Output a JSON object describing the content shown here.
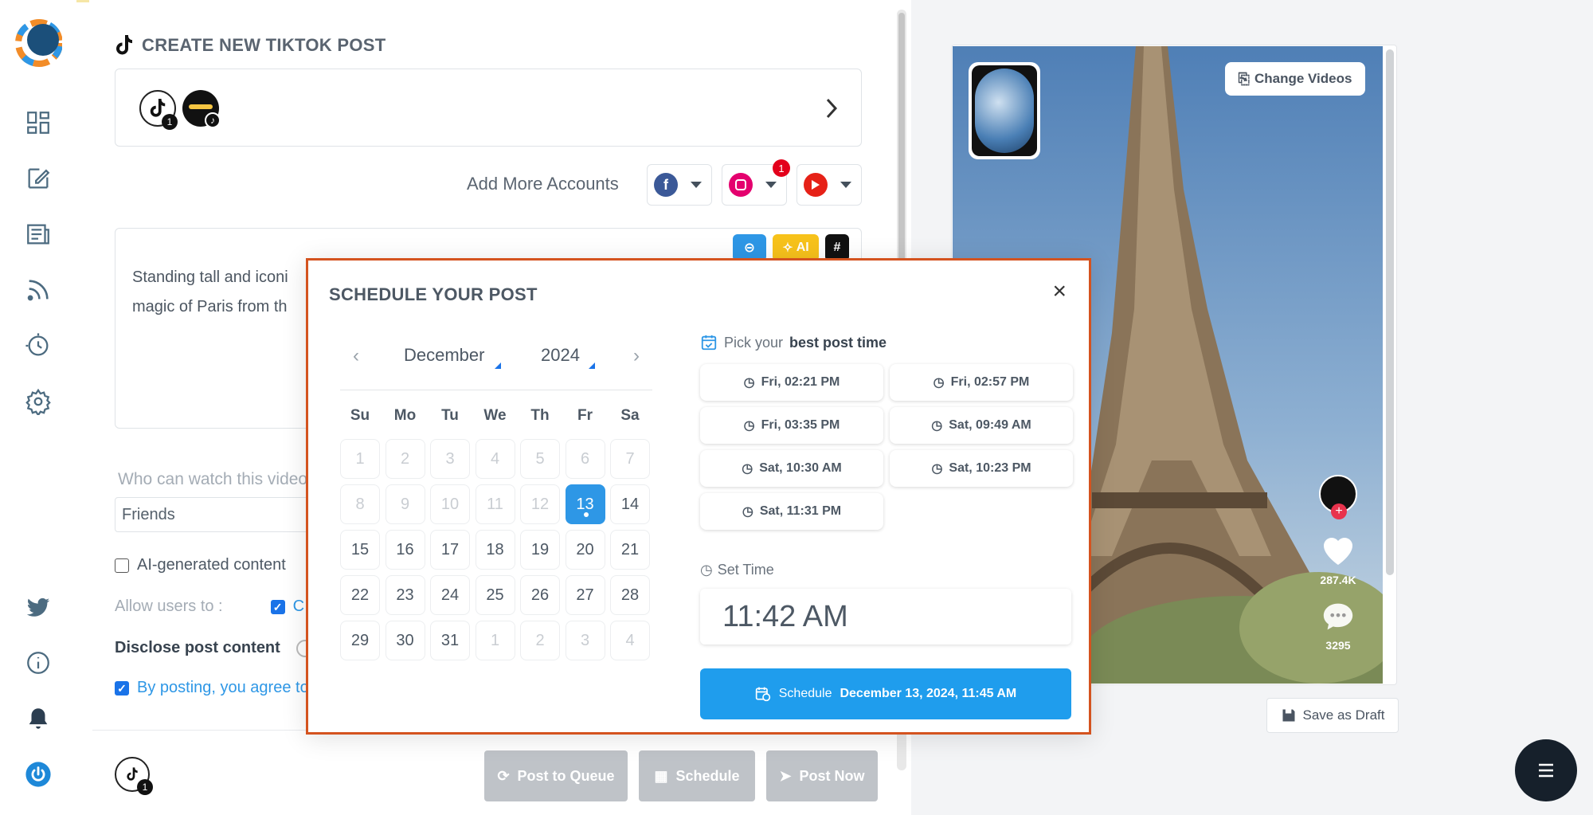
{
  "rail": {
    "items": [
      "dashboard-icon",
      "compose-icon",
      "posts-icon",
      "rss-icon",
      "history-icon",
      "settings-icon",
      "twitter-icon",
      "info-icon",
      "bell-icon",
      "power-icon"
    ]
  },
  "header": {
    "title": "CREATE NEW TIKTOK POST"
  },
  "accounts": {
    "primary_badge": "1",
    "more_label": "Add More Accounts",
    "instagram_badge": "1"
  },
  "caption": {
    "lines": [
      "Standing tall and iconi",
      "magic of Paris from th"
    ],
    "ai_label": "AI"
  },
  "visibility": {
    "label": "Who can watch this video",
    "value": "Friends"
  },
  "options": {
    "ai_generated": "AI-generated content",
    "allow_users": "Allow users to :",
    "allow_first": "C",
    "disclose": "Disclose post content",
    "agree": "By posting, you agree to"
  },
  "footer": {
    "avatar_badge": "1",
    "post_to_queue": "Post to Queue",
    "schedule": "Schedule",
    "post_now": "Post Now"
  },
  "preview": {
    "change_videos": "Change Videos",
    "likes": "287.4K",
    "comments": "3295",
    "save_draft": "Save as Draft"
  },
  "modal": {
    "title": "SCHEDULE YOUR POST",
    "close": "×",
    "month": "December",
    "year": "2024",
    "weekdays": [
      "Su",
      "Mo",
      "Tu",
      "We",
      "Th",
      "Fr",
      "Sa"
    ],
    "weeks": [
      [
        [
          "1",
          "m"
        ],
        [
          "2",
          "m"
        ],
        [
          "3",
          "m"
        ],
        [
          "4",
          "m"
        ],
        [
          "5",
          "m"
        ],
        [
          "6",
          "m"
        ],
        [
          "7",
          "m"
        ]
      ],
      [
        [
          "8",
          "m"
        ],
        [
          "9",
          "m"
        ],
        [
          "10",
          "m"
        ],
        [
          "11",
          "m"
        ],
        [
          "12",
          "m"
        ],
        [
          "13",
          "s"
        ],
        [
          "14",
          ""
        ]
      ],
      [
        [
          "15",
          ""
        ],
        [
          "16",
          ""
        ],
        [
          "17",
          ""
        ],
        [
          "18",
          ""
        ],
        [
          "19",
          ""
        ],
        [
          "20",
          ""
        ],
        [
          "21",
          ""
        ]
      ],
      [
        [
          "22",
          ""
        ],
        [
          "23",
          ""
        ],
        [
          "24",
          ""
        ],
        [
          "25",
          ""
        ],
        [
          "26",
          ""
        ],
        [
          "27",
          ""
        ],
        [
          "28",
          ""
        ]
      ],
      [
        [
          "29",
          ""
        ],
        [
          "30",
          ""
        ],
        [
          "31",
          ""
        ],
        [
          "1",
          "m"
        ],
        [
          "2",
          "m"
        ],
        [
          "3",
          "m"
        ],
        [
          "4",
          "m"
        ]
      ]
    ],
    "pick_prefix": "Pick your",
    "pick_bold": "best post time",
    "slots": [
      "Fri, 02:21 PM",
      "Fri, 02:57 PM",
      "Fri, 03:35 PM",
      "Sat, 09:49 AM",
      "Sat, 10:30 AM",
      "Sat, 10:23 PM",
      "Sat, 11:31 PM"
    ],
    "set_time_label": "Set Time",
    "time_value": "11:42 AM",
    "schedule_label": "Schedule",
    "schedule_datetime": "December 13, 2024, 11:45 AM"
  },
  "colors": {
    "accent": "#1f9ded",
    "modal_border": "#d4531f",
    "selected_day": "#2e97e6",
    "disabled_button": "#bfc3c8"
  }
}
